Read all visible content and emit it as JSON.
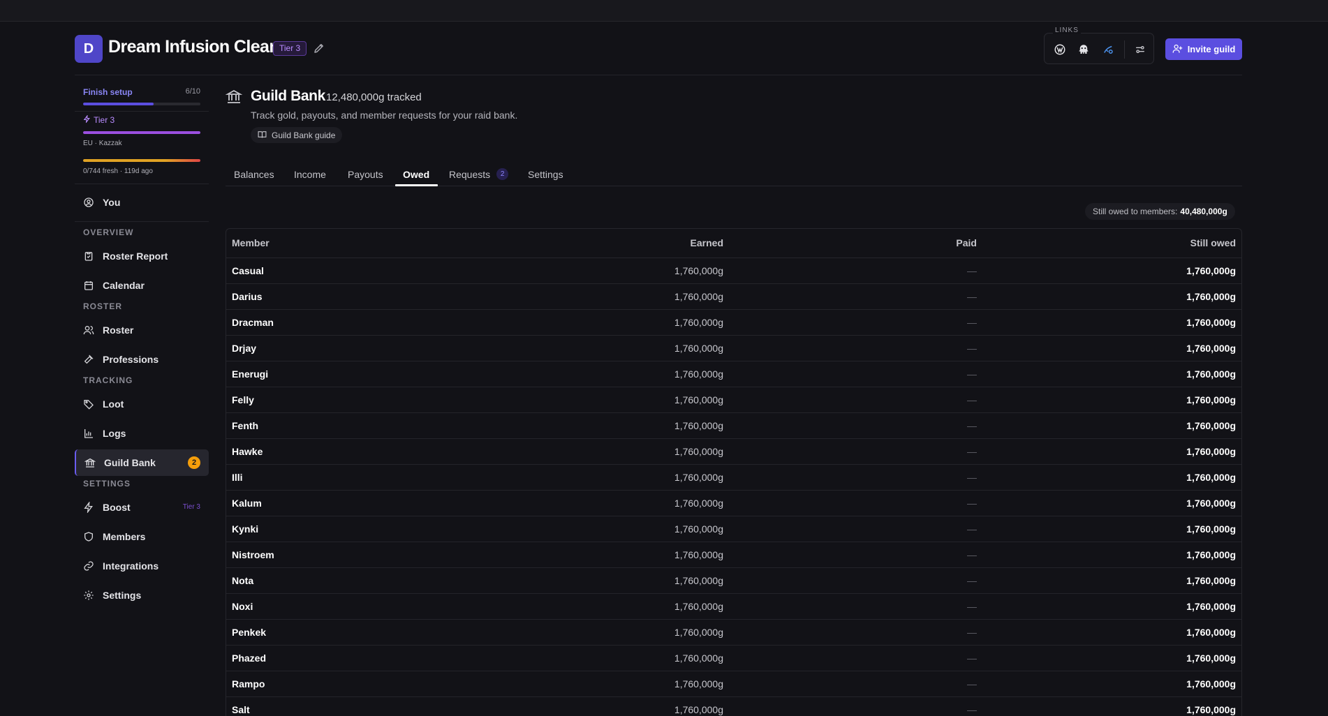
{
  "guild": {
    "initial": "D",
    "name": "Dream Infusion Clean",
    "tier": "Tier 3",
    "links_label": "LINKS",
    "invite_label": "Invite guild"
  },
  "sidebar": {
    "setup_label": "Finish setup",
    "setup_count": "6/10",
    "setup_progress": 0.6,
    "tier_label": "Tier 3",
    "region": "EU · Kazzak",
    "fresh": "0/744 fresh · 119d ago",
    "you": "You",
    "sections": {
      "overview": "OVERVIEW",
      "roster": "ROSTER",
      "tracking": "TRACKING",
      "settings": "SETTINGS"
    },
    "items": {
      "roster_report": "Roster Report",
      "calendar": "Calendar",
      "roster": "Roster",
      "professions": "Professions",
      "loot": "Loot",
      "logs": "Logs",
      "guild_bank": "Guild Bank",
      "guild_bank_badge": "2",
      "boost": "Boost",
      "boost_tier": "Tier 3",
      "members": "Members",
      "integrations": "Integrations",
      "settings": "Settings"
    }
  },
  "main": {
    "title": "Guild Bank",
    "tracked": "12,480,000g tracked",
    "description": "Track gold, payouts, and member requests for your raid bank.",
    "guide_label": "Guild Bank guide",
    "tabs": [
      {
        "label": "Balances"
      },
      {
        "label": "Income"
      },
      {
        "label": "Payouts"
      },
      {
        "label": "Owed"
      },
      {
        "label": "Requests",
        "count": "2"
      },
      {
        "label": "Settings"
      }
    ],
    "summary_label": "Still owed to members:",
    "summary_value": "40,480,000g",
    "columns": [
      "Member",
      "Earned",
      "Paid",
      "Still owed"
    ],
    "rows": [
      {
        "member": "Casual",
        "earned": "1,760,000g",
        "paid": "—",
        "owed": "1,760,000g"
      },
      {
        "member": "Darius",
        "earned": "1,760,000g",
        "paid": "—",
        "owed": "1,760,000g"
      },
      {
        "member": "Dracman",
        "earned": "1,760,000g",
        "paid": "—",
        "owed": "1,760,000g"
      },
      {
        "member": "Drjay",
        "earned": "1,760,000g",
        "paid": "—",
        "owed": "1,760,000g"
      },
      {
        "member": "Enerugi",
        "earned": "1,760,000g",
        "paid": "—",
        "owed": "1,760,000g"
      },
      {
        "member": "Felly",
        "earned": "1,760,000g",
        "paid": "—",
        "owed": "1,760,000g"
      },
      {
        "member": "Fenth",
        "earned": "1,760,000g",
        "paid": "—",
        "owed": "1,760,000g"
      },
      {
        "member": "Hawke",
        "earned": "1,760,000g",
        "paid": "—",
        "owed": "1,760,000g"
      },
      {
        "member": "Illi",
        "earned": "1,760,000g",
        "paid": "—",
        "owed": "1,760,000g"
      },
      {
        "member": "Kalum",
        "earned": "1,760,000g",
        "paid": "—",
        "owed": "1,760,000g"
      },
      {
        "member": "Kynki",
        "earned": "1,760,000g",
        "paid": "—",
        "owed": "1,760,000g"
      },
      {
        "member": "Nistroem",
        "earned": "1,760,000g",
        "paid": "—",
        "owed": "1,760,000g"
      },
      {
        "member": "Nota",
        "earned": "1,760,000g",
        "paid": "—",
        "owed": "1,760,000g"
      },
      {
        "member": "Noxi",
        "earned": "1,760,000g",
        "paid": "—",
        "owed": "1,760,000g"
      },
      {
        "member": "Penkek",
        "earned": "1,760,000g",
        "paid": "—",
        "owed": "1,760,000g"
      },
      {
        "member": "Phazed",
        "earned": "1,760,000g",
        "paid": "—",
        "owed": "1,760,000g"
      },
      {
        "member": "Rampo",
        "earned": "1,760,000g",
        "paid": "—",
        "owed": "1,760,000g"
      },
      {
        "member": "Salt",
        "earned": "1,760,000g",
        "paid": "—",
        "owed": "1,760,000g"
      }
    ]
  },
  "colors": {
    "accent": "#5b4ee0",
    "tier_purple": "#b98cff",
    "badge_orange": "#f59e0b"
  },
  "icons": [
    "edit-icon",
    "wowhead-icon",
    "raidbots-icon",
    "raiderio-icon",
    "filter-icon",
    "user-plus-icon",
    "bank-icon",
    "book-icon",
    "user-circle-icon",
    "clipboard-icon",
    "calendar-icon",
    "users-icon",
    "hammer-icon",
    "tag-icon",
    "bar-chart-icon",
    "lightning-icon",
    "shield-icon",
    "link-icon",
    "gear-icon"
  ]
}
